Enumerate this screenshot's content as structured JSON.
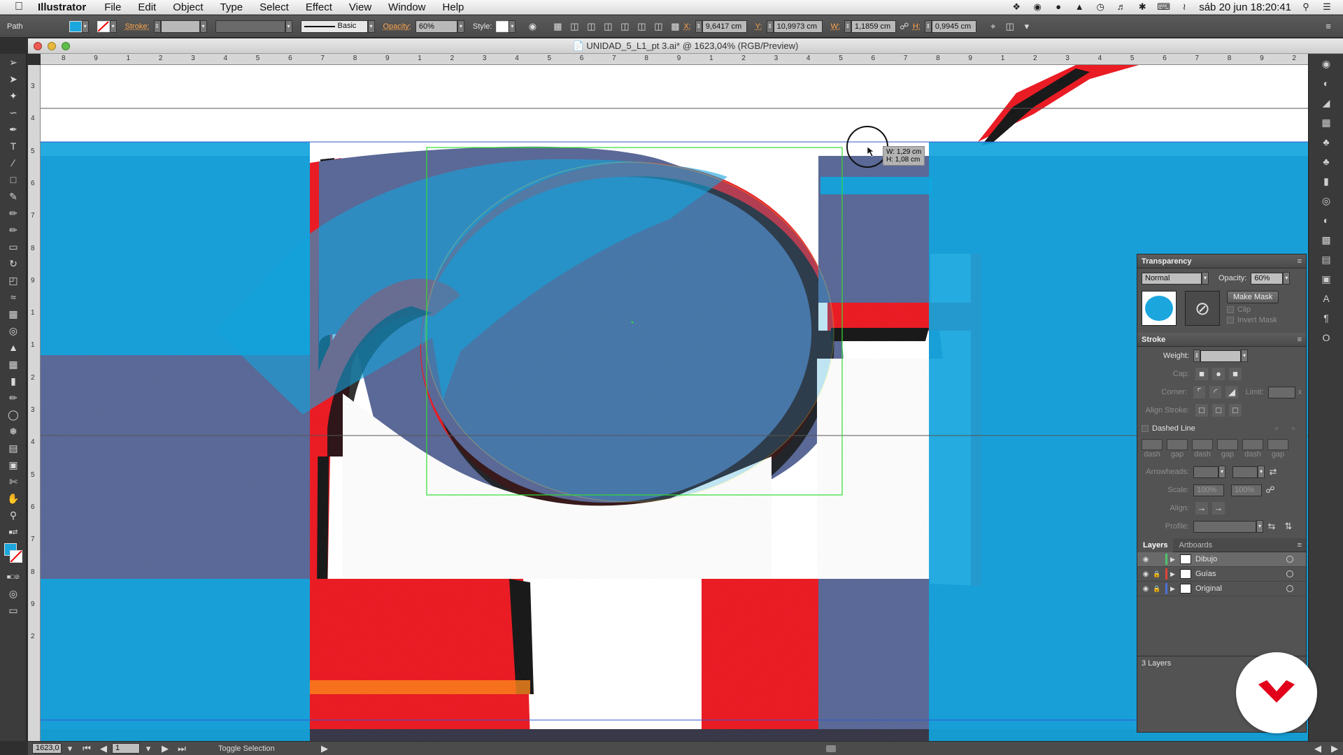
{
  "menubar": {
    "app_name": "Illustrator",
    "items": [
      "File",
      "Edit",
      "Object",
      "Type",
      "Select",
      "Effect",
      "View",
      "Window",
      "Help"
    ],
    "clock": "sáb 20 jun  18:20:41"
  },
  "controlbar": {
    "selection_type": "Path",
    "stroke_label": "Stroke:",
    "brush_style": "Basic",
    "opacity_label": "Opacity:",
    "opacity_value": "60%",
    "style_label": "Style:",
    "x_label": "X:",
    "x_value": "9,6417 cm",
    "y_label": "Y:",
    "y_value": "10,9973 cm",
    "w_label": "W:",
    "w_value": "1,1859 cm",
    "h_label": "H:",
    "h_value": "0,9945 cm",
    "fill_color": "#1ba6de"
  },
  "document": {
    "title": "UNIDAD_5_L1_pt 3.ai* @ 1623,04% (RGB/Preview)"
  },
  "ruler_top": {
    "labels": [
      "8",
      "9",
      "1",
      "2",
      "3",
      "4",
      "5",
      "6",
      "7",
      "8",
      "9",
      "1",
      "2",
      "3",
      "4",
      "5",
      "6",
      "7",
      "8",
      "9",
      "1",
      "2",
      "3",
      "4",
      "5",
      "6",
      "7",
      "8",
      "9",
      "1",
      "2",
      "3",
      "4",
      "5",
      "6",
      "7",
      "8",
      "9",
      "2"
    ]
  },
  "ruler_left": {
    "labels": [
      "3",
      "4",
      "5",
      "6",
      "7",
      "8",
      "9",
      "1",
      "1",
      "2",
      "3",
      "4",
      "5",
      "6",
      "7",
      "8",
      "9",
      "2"
    ]
  },
  "canvas": {
    "measure_w": "W: 1,29 cm",
    "measure_h": "H: 1,08 cm",
    "colors": {
      "cyan": "#12a4dc",
      "slate": "#5c6b9a",
      "red": "#ee1c25",
      "black": "#1a1a1a"
    }
  },
  "transparency_panel": {
    "title": "Transparency",
    "blend_mode": "Normal",
    "opacity_label": "Opacity:",
    "opacity_value": "60%",
    "make_mask": "Make Mask",
    "clip": "Clip",
    "invert_mask": "Invert Mask",
    "thumb_color": "#1ba6de"
  },
  "stroke_panel": {
    "title": "Stroke",
    "weight_label": "Weight:",
    "cap_label": "Cap:",
    "corner_label": "Corner:",
    "limit_label": "Limit:",
    "limit_x": "x",
    "align_label": "Align Stroke:",
    "dashed_line": "Dashed Line",
    "dash_labels": [
      "dash",
      "gap",
      "dash",
      "gap",
      "dash",
      "gap"
    ],
    "arrowheads_label": "Arrowheads:",
    "scale_label": "Scale:",
    "scale_1": "100%",
    "scale_2": "100%",
    "align_arrow_label": "Align:",
    "profile_label": "Profile:"
  },
  "layers_panel": {
    "tabs": [
      "Layers",
      "Artboards"
    ],
    "layers": [
      {
        "name": "Dibujo",
        "color": "#4ec36e",
        "locked": false
      },
      {
        "name": "Guías",
        "color": "#e0443a",
        "locked": true
      },
      {
        "name": "Original",
        "color": "#4f6fd6",
        "locked": true
      }
    ],
    "count": "3 Layers"
  },
  "statusbar": {
    "zoom": "1623,0",
    "artboard": "1",
    "status_text": "Toggle Selection"
  },
  "logo": {
    "color": "#e2001a"
  }
}
